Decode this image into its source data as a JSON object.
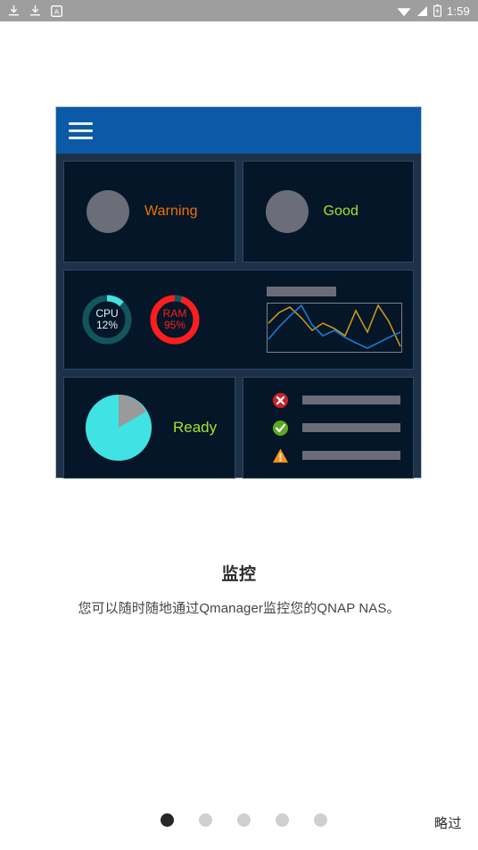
{
  "statusbar": {
    "icons_left": [
      "download-icon",
      "download-icon",
      "letter-a-badge-icon"
    ],
    "icons_right": [
      "wifi-icon",
      "cellular-signal-icon",
      "battery-icon"
    ],
    "time": "1:59",
    "background_color": "#9e9e9e"
  },
  "mockup": {
    "header": {
      "menu_icon": "hamburger-menu-icon",
      "background_color": "#0a5aa7"
    },
    "status_cells": [
      {
        "label": "Warning",
        "color": "#f07000",
        "indicator": "gray-circle"
      },
      {
        "label": "Good",
        "color": "#a6e22b",
        "indicator": "gray-circle"
      }
    ],
    "gauges": [
      {
        "name": "CPU",
        "value": 12,
        "value_label": "12%",
        "arc_color": "#3fe3e3",
        "track_color": "#13555c",
        "text_color": "#e6eef4"
      },
      {
        "name": "RAM",
        "value": 95,
        "value_label": "95%",
        "arc_color": "#ff1d1d",
        "track_color": "#14565e",
        "text_color": "#ff1d1d"
      }
    ],
    "chart": {
      "caption_placeholder": "",
      "series": [
        {
          "name": "orange-series",
          "color": "#c8941f",
          "points": [
            22,
            10,
            4,
            16,
            30,
            22,
            28,
            36,
            8,
            32,
            2,
            20,
            48
          ]
        },
        {
          "name": "blue-series",
          "color": "#1e78d2",
          "points": [
            40,
            26,
            14,
            2,
            24,
            36,
            30,
            38,
            44,
            50,
            44,
            38,
            32
          ]
        }
      ]
    },
    "pie": {
      "label": "Ready",
      "label_color": "#a6e22b",
      "slices": [
        {
          "name": "ready",
          "percent": 82,
          "color": "#3fe3e3"
        },
        {
          "name": "other",
          "percent": 18,
          "color": "#9a9a9a"
        }
      ]
    },
    "list_items": [
      {
        "icon": "error-circle-icon",
        "icon_color": "#cc2027",
        "placeholder_bar": true
      },
      {
        "icon": "success-circle-icon",
        "icon_color": "#5aaa1e",
        "placeholder_bar": true
      },
      {
        "icon": "warning-triangle-icon",
        "icon_color": "#f39118",
        "placeholder_bar": true
      }
    ]
  },
  "caption": {
    "title": "监控",
    "subtitle": "您可以随时随地通过Qmanager监控您的QNAP NAS。"
  },
  "footer": {
    "page_count": 5,
    "active_page": 1,
    "skip_label": "略过",
    "active_dot_color": "#262626",
    "inactive_dot_color": "#cfcfcf"
  }
}
